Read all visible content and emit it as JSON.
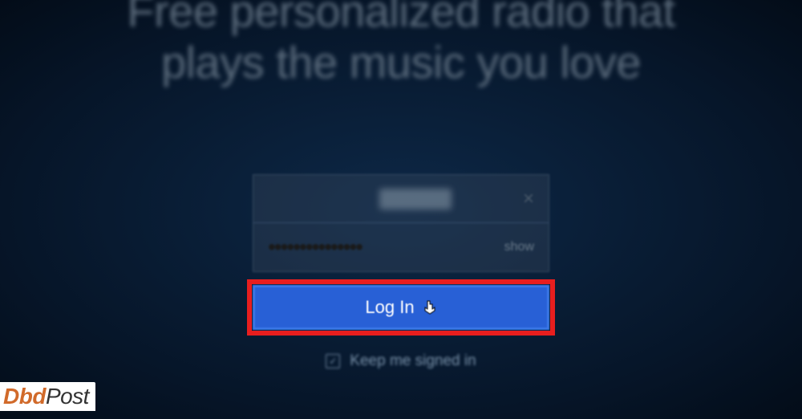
{
  "headline": {
    "line1": "Free personalized radio that",
    "line2": "plays the music you love"
  },
  "form": {
    "email": {
      "value": "",
      "clear_icon": "×"
    },
    "password": {
      "masked": "•••••••••••••••",
      "show_label": "show"
    },
    "login_button": "Log In",
    "keep_signed": {
      "checked": true,
      "checkmark": "✓",
      "label": "Keep me signed in"
    }
  },
  "cursor_glyph": "👆",
  "watermark": {
    "part1": "Dbd",
    "part2": "Post"
  }
}
